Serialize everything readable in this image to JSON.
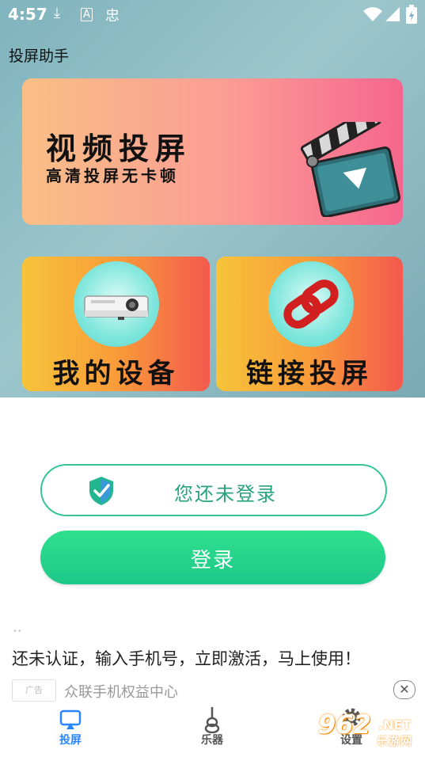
{
  "status_bar": {
    "time": "4:57"
  },
  "app": {
    "title": "投屏助手"
  },
  "cards": {
    "video": {
      "title": "视频投屏",
      "subtitle": "高清投屏无卡顿"
    },
    "device": {
      "label": "我的设备"
    },
    "link": {
      "label": "链接投屏"
    }
  },
  "account": {
    "status_text": "您还未登录",
    "login_label": "登录"
  },
  "ad": {
    "text": "还未认证，输入手机号，立即激活，马上使用！",
    "tag": "广告",
    "source": "众联手机权益中心"
  },
  "bottom_nav": {
    "items": [
      {
        "label": "投屏",
        "icon": "cast-icon",
        "active": true
      },
      {
        "label": "乐器",
        "icon": "guitar-icon",
        "active": false
      },
      {
        "label": "设置",
        "icon": "gear-icon",
        "active": false
      }
    ]
  },
  "watermark": {
    "brand": "962",
    "domain": ".NET",
    "name": "乐游网"
  },
  "colors": {
    "accent": "#2a86ff",
    "green": "#1ec88a",
    "video_card_end": "#f5668e",
    "small_card_start": "#f6c43a"
  }
}
